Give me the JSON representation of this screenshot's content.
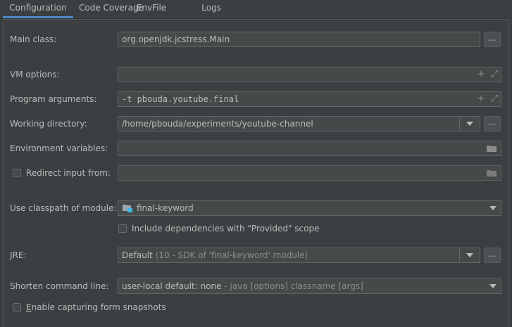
{
  "tabs": [
    "Configuration",
    "Code Coverage",
    "EnvFile",
    "Logs"
  ],
  "form": {
    "main_class": {
      "label": "Main class:",
      "value": "org.openjdk.jcstress.Main"
    },
    "vm_options": {
      "label": "VM options:",
      "value": ""
    },
    "program_args": {
      "label": "Program arguments:",
      "value": "-t pbouda.youtube.final"
    },
    "working_dir": {
      "label": "Working directory:",
      "value": "/home/pbouda/experiments/youtube-channel"
    },
    "env_vars": {
      "label": "Environment variables:",
      "value": ""
    },
    "redirect": {
      "label": "Redirect input from:",
      "value": "",
      "checked": false
    },
    "classpath": {
      "label": "Use classpath of module:",
      "value": "final-keyword"
    },
    "include_deps": {
      "label": "Include dependencies with \"Provided\" scope",
      "checked": false
    },
    "jre": {
      "label": "JRE:",
      "value": "Default",
      "hint": "(10 - SDK of 'final-keyword' module)"
    },
    "shorten": {
      "label": "Shorten command line:",
      "value": "user-local default: none",
      "hint": "- java [options] classname [args]"
    },
    "snapshots": {
      "label_underlined": "E",
      "label_rest": "nable capturing form snapshots",
      "checked": false
    }
  },
  "browse_label": "...",
  "colors": {
    "accent": "#4a88c7",
    "background": "#3c3f41",
    "field": "#45494a"
  }
}
